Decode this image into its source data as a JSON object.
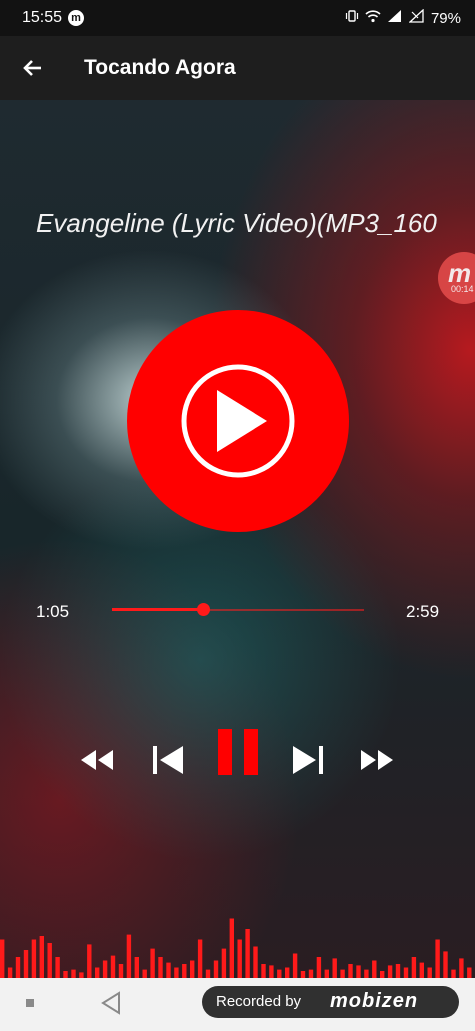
{
  "status_bar": {
    "time": "15:55",
    "battery": "79%",
    "icons": [
      "mobizen-icon",
      "vibrate-icon",
      "wifi-icon",
      "signal-icon",
      "signal-icon-2",
      "battery-icon"
    ]
  },
  "app_bar": {
    "title": "Tocando Agora",
    "back_icon": "arrow-left-icon"
  },
  "player": {
    "song_title": "Evangeline (Lyric Video)(MP3_160",
    "elapsed": "1:05",
    "total": "2:59",
    "progress": 0.36,
    "artwork_icon": "play-circle-icon",
    "state": "playing"
  },
  "floating_recorder": {
    "logo": "m",
    "timer": "00:14"
  },
  "controls": {
    "rewind_icon": "rewind-icon",
    "previous_icon": "skip-previous-icon",
    "pause_icon": "pause-icon",
    "next_icon": "skip-next-icon",
    "fast_forward_icon": "fast-forward-icon"
  },
  "visualizer": {
    "bars": [
      0.55,
      0.15,
      0.3,
      0.4,
      0.55,
      0.6,
      0.5,
      0.3,
      0.1,
      0.12,
      0.08,
      0.48,
      0.15,
      0.25,
      0.32,
      0.2,
      0.62,
      0.3,
      0.12,
      0.42,
      0.3,
      0.22,
      0.15,
      0.2,
      0.25,
      0.55,
      0.12,
      0.25,
      0.42,
      0.85,
      0.55,
      0.7,
      0.45,
      0.2,
      0.18,
      0.12,
      0.15,
      0.35,
      0.1,
      0.12,
      0.3,
      0.12,
      0.28,
      0.12,
      0.2,
      0.18,
      0.12,
      0.25,
      0.1,
      0.18,
      0.2,
      0.15,
      0.3,
      0.22,
      0.15,
      0.55,
      0.38,
      0.12,
      0.28,
      0.15
    ],
    "color": "#ff1a1a"
  },
  "nav_bar": {
    "recorded_label": "Recorded by",
    "brand": "mobizen"
  },
  "colors": {
    "accent": "#ff0000",
    "status_bg": "#121212",
    "appbar_bg": "#1e1e1e",
    "nav_bg": "#f2f2f2"
  }
}
